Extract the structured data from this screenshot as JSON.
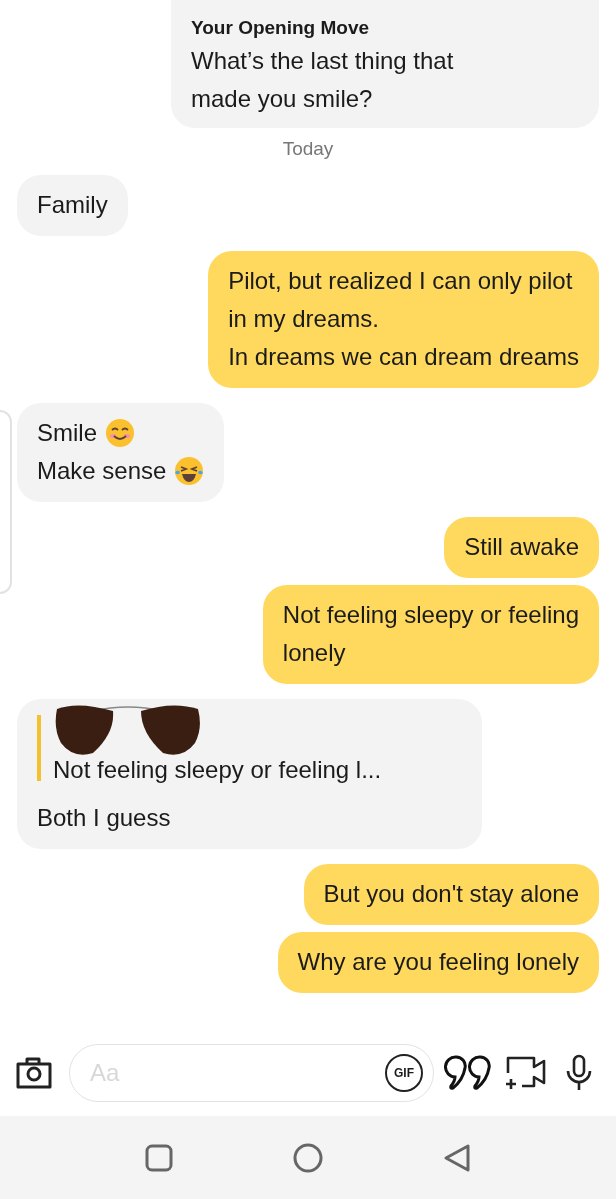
{
  "opening_move": {
    "label": "Your Opening Move",
    "question": "What’s the last thing that\nmade you smile?"
  },
  "date_divider": "Today",
  "messages": [
    {
      "kind": "text",
      "sent": false,
      "text": "Family"
    },
    {
      "kind": "text",
      "sent": true,
      "text": "Pilot, but realized I can only pilot\nin my dreams.\nIn dreams we can dream dreams"
    },
    {
      "kind": "emoji_lines",
      "sent": false,
      "lines": [
        {
          "text": "Smile",
          "kind": "smiling"
        },
        {
          "text": "Make sense",
          "kind": "laughing"
        }
      ]
    },
    {
      "kind": "text",
      "sent": true,
      "text": "Still awake"
    },
    {
      "kind": "text",
      "sent": true,
      "text": "Not feeling sleepy or feeling\nlonely"
    },
    {
      "kind": "reply",
      "sent": false,
      "quote": "Not feeling sleepy or feeling l...",
      "text": "Both I guess"
    },
    {
      "kind": "text",
      "sent": true,
      "text": "But you don't stay alone"
    },
    {
      "kind": "text",
      "sent": true,
      "text": "Why are you feeling lonely"
    }
  ],
  "composer": {
    "placeholder": "Aa",
    "gif_label": "GIF"
  }
}
